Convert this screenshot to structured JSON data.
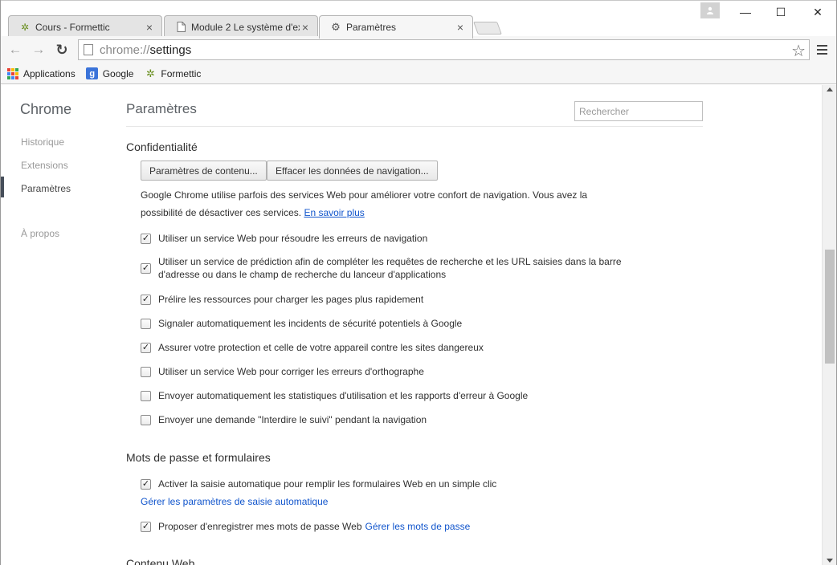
{
  "tabs": [
    {
      "title": "Cours - Formettic",
      "icon": "formettic-icon"
    },
    {
      "title": "Module 2 Le système d'ex",
      "icon": "page-icon"
    },
    {
      "title": "Paramètres",
      "icon": "gear-icon"
    }
  ],
  "window": {
    "minimize": "—",
    "maximize": "☐",
    "close": "✕"
  },
  "omnibox": {
    "scheme": "chrome://",
    "host": "settings"
  },
  "bookmarks": [
    {
      "label": "Applications",
      "icon": "apps-grid-icon"
    },
    {
      "label": "Google",
      "icon": "google-icon",
      "glyph": "g"
    },
    {
      "label": "Formettic",
      "icon": "formettic-icon"
    }
  ],
  "sidebar": {
    "title": "Chrome",
    "items": [
      {
        "label": "Historique"
      },
      {
        "label": "Extensions"
      },
      {
        "label": "Paramètres",
        "selected": true
      },
      {
        "label": "À propos"
      }
    ]
  },
  "main": {
    "title": "Paramètres",
    "search_placeholder": "Rechercher"
  },
  "privacy": {
    "title": "Confidentialité",
    "content_settings_button": "Paramètres de contenu...",
    "clear_data_button": "Effacer les données de navigation...",
    "intro": "Google Chrome utilise parfois des services Web pour améliorer votre confort de navigation. Vous avez la possibilité de désactiver ces services.",
    "learn_more": "En savoir plus",
    "options": [
      {
        "label": "Utiliser un service Web pour résoudre les erreurs de navigation",
        "checked": true
      },
      {
        "label": "Utiliser un service de prédiction afin de compléter les requêtes de recherche et les URL saisies dans la barre d'adresse ou dans le champ de recherche du lanceur d'applications",
        "checked": true
      },
      {
        "label": "Prélire les ressources pour charger les pages plus rapidement",
        "checked": true
      },
      {
        "label": "Signaler automatiquement les incidents de sécurité potentiels à Google",
        "checked": false
      },
      {
        "label": "Assurer votre protection et celle de votre appareil contre les sites dangereux",
        "checked": true
      },
      {
        "label": "Utiliser un service Web pour corriger les erreurs d'orthographe",
        "checked": false
      },
      {
        "label": "Envoyer automatiquement les statistiques d'utilisation et les rapports d'erreur à Google",
        "checked": false
      },
      {
        "label": "Envoyer une demande \"Interdire le suivi\" pendant la navigation",
        "checked": false
      }
    ]
  },
  "passwords": {
    "title": "Mots de passe et formulaires",
    "autofill_label": "Activer la saisie automatique pour remplir les formulaires Web en un simple clic",
    "autofill_checked": true,
    "autofill_manage_link": "Gérer les paramètres de saisie automatique",
    "save_passwords_label": "Proposer d'enregistrer mes mots de passe Web",
    "save_passwords_checked": true,
    "manage_passwords_link": "Gérer les mots de passe"
  },
  "web_content": {
    "title": "Contenu Web"
  }
}
